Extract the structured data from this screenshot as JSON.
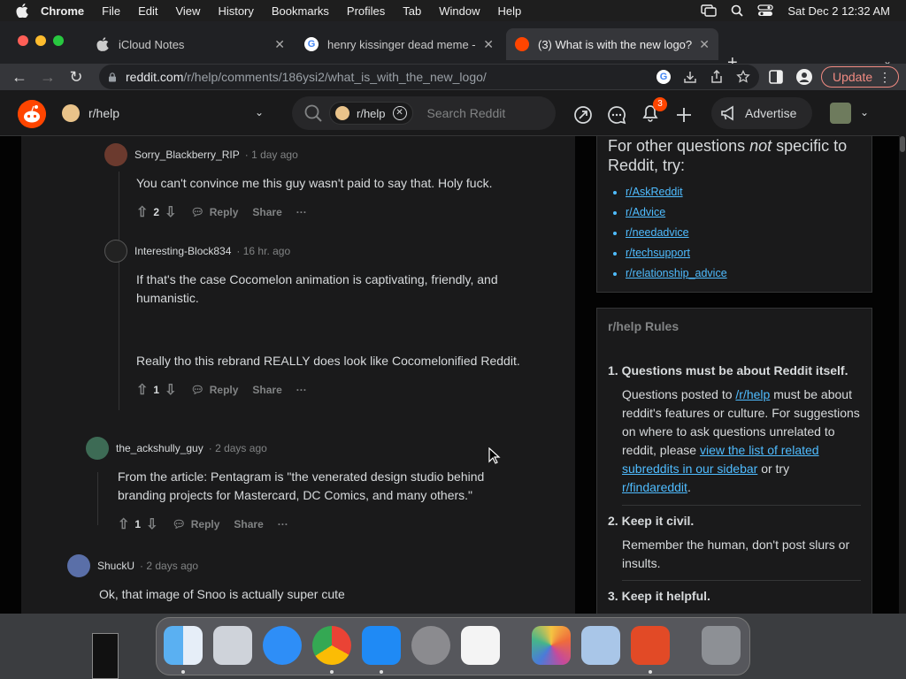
{
  "menubar": {
    "items": [
      "Chrome",
      "File",
      "Edit",
      "View",
      "History",
      "Bookmarks",
      "Profiles",
      "Tab",
      "Window",
      "Help"
    ],
    "datetime": "Sat Dec 2  12:32 AM"
  },
  "tabs": [
    {
      "title": "iCloud Notes",
      "favicon": "apple-icon"
    },
    {
      "title": "henry kissinger dead meme - G",
      "favicon": "google-icon"
    },
    {
      "title": "(3) What is with the new logo?",
      "favicon": "reddit-icon"
    }
  ],
  "toolbar": {
    "url_host": "reddit.com",
    "url_path": "/r/help/comments/186ysi2/what_is_with_the_new_logo/",
    "update_label": "Update"
  },
  "header": {
    "community": "r/help",
    "search_chip": "r/help",
    "search_placeholder": "Search Reddit",
    "notif_count": "3",
    "advertise": "Advertise"
  },
  "comments": [
    {
      "user": "Sorry_Blackberry_RIP",
      "time": "1 day ago",
      "body": "You can't convince me this guy wasn't paid to say that. Holy fuck.",
      "score": "2"
    },
    {
      "user": "Interesting-Block834",
      "time": "16 hr. ago",
      "body1": "If that's the case Cocomelon animation is captivating, friendly, and humanistic.",
      "body2": "Really tho this rebrand REALLY does look like Cocomelonified Reddit.",
      "score": "1"
    },
    {
      "user": "the_ackshully_guy",
      "time": "2 days ago",
      "body": "From the article: Pentagram is \"the venerated design studio behind branding projects for Mastercard, DC Comics, and many others.\"",
      "score": "1"
    },
    {
      "user": "ShuckU",
      "time": "2 days ago",
      "body": "Ok, that image of Snoo is actually super cute",
      "score": ""
    }
  ],
  "actions": {
    "reply": "Reply",
    "share": "Share",
    "more": "···"
  },
  "sidebar": {
    "other_q_pre": "For other questions ",
    "other_q_em": "not",
    "other_q_post": " specific to Reddit, try:",
    "links": [
      "r/AskReddit",
      "r/Advice",
      "r/needadvice",
      "r/techsupport",
      "r/relationship_advice"
    ],
    "rules_title": "r/help Rules",
    "rules": [
      {
        "num": "1.",
        "title": "Questions must be about Reddit itself.",
        "d1": "Questions posted to ",
        "l1": "/r/help",
        "d2": " must be about reddit's features or culture. For suggestions on where to ask questions unrelated to reddit, please ",
        "l2": "view the list of related subreddits in our sidebar",
        "d3": " or try ",
        "l3": "r/findareddit",
        "d4": "."
      },
      {
        "num": "2.",
        "title": "Keep it civil.",
        "desc": "Remember the human, don't post slurs or insults."
      },
      {
        "num": "3.",
        "title": "Keep it helpful.",
        "desc": ""
      }
    ]
  },
  "dock": [
    "finder-icon",
    "launchpad-icon",
    "safari-icon",
    "chrome-icon",
    "app-store-icon",
    "system-settings-icon",
    "textedit-icon",
    "photos-icon",
    "preview-icon",
    "remote-desktop-icon",
    "trash-icon"
  ],
  "colors": {
    "reddit_orange": "#ff4500",
    "link_blue": "#4fbcff",
    "bg_dark": "#030303",
    "card": "#1a1a1b"
  }
}
